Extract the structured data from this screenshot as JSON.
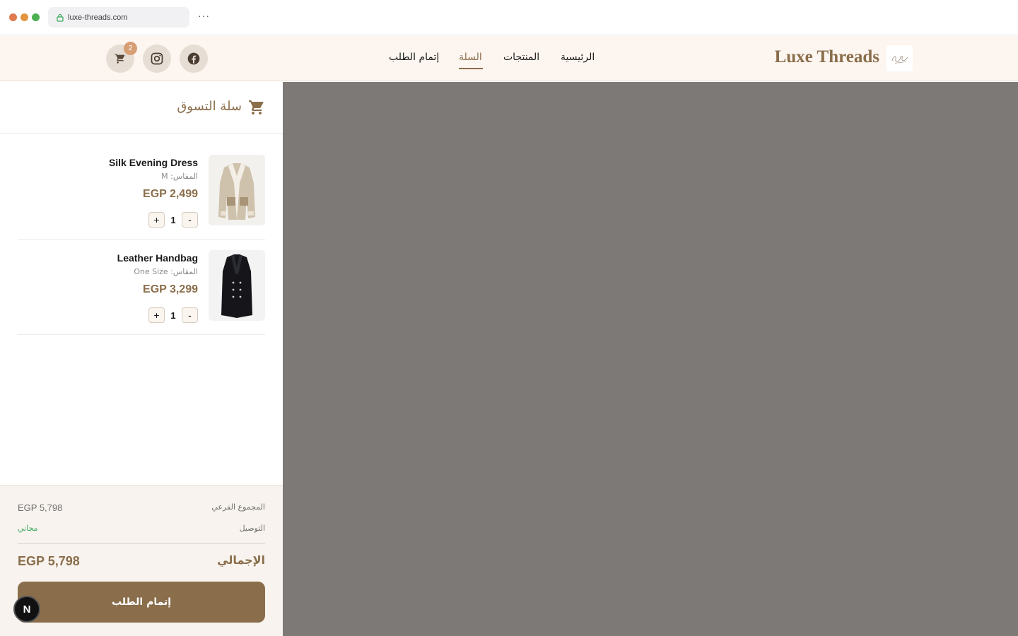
{
  "browser": {
    "url": "luxe-threads.com",
    "menu_icon": "more-dots-icon"
  },
  "header": {
    "brand": "Luxe Threads",
    "nav": [
      {
        "label": "الرئيسية",
        "active": false
      },
      {
        "label": "المنتجات",
        "active": false
      },
      {
        "label": "السلة",
        "active": true
      },
      {
        "label": "إتمام الطلب",
        "active": false
      }
    ],
    "cart_count": "2",
    "icons": [
      "cart-icon",
      "instagram-icon",
      "facebook-icon"
    ]
  },
  "cart": {
    "title": "سلة التسوق",
    "items": [
      {
        "name": "Silk Evening Dress",
        "size": "المقاس: M",
        "price": "EGP 2,499",
        "qty": "1",
        "plus": "+",
        "minus": "-"
      },
      {
        "name": "Leather Handbag",
        "size": "المقاس: One Size",
        "price": "EGP 3,299",
        "qty": "1",
        "plus": "+",
        "minus": "-"
      }
    ],
    "summary": {
      "subtotal_label": "المجموع الفرعي",
      "subtotal_value": "EGP 5,798",
      "delivery_label": "التوصيل",
      "delivery_value": "مجاني",
      "total_label": "الإجمالي",
      "total_value": "EGP 5,798",
      "checkout_label": "إتمام الطلب"
    }
  },
  "dev_badge": "N",
  "colors": {
    "accent": "#8a6e4b",
    "header_bg": "#fdf5ef",
    "overlay": "#7d7976",
    "free_green": "#3aa65a",
    "badge": "#d79e74"
  }
}
